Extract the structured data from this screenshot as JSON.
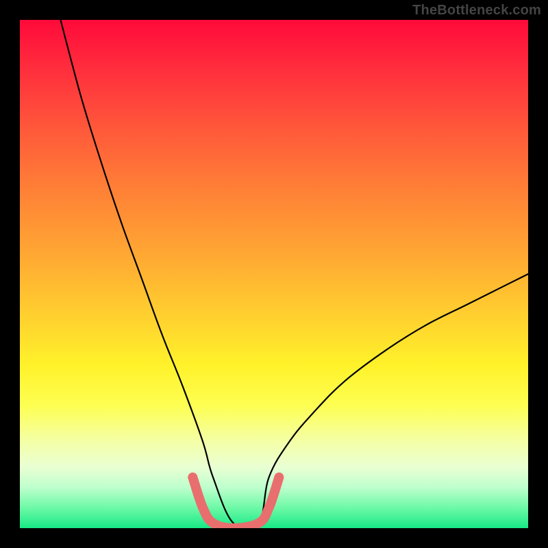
{
  "watermark": "TheBottleneck.com",
  "chart_data": {
    "type": "line",
    "title": "",
    "xlabel": "",
    "ylabel": "",
    "xlim": [
      0,
      100
    ],
    "ylim": [
      0,
      100
    ],
    "grid": false,
    "legend": false,
    "series": [
      {
        "name": "black-curve",
        "description": "V-shaped bottleneck curve with flat minimum, approaches 100% at left edge, about 50% at right edge, zero between ~38 and ~47",
        "color": "#000000",
        "x": [
          8,
          12,
          16,
          20,
          24,
          28,
          32,
          36,
          38,
          42,
          47,
          49,
          53,
          58,
          64,
          72,
          80,
          88,
          96,
          100
        ],
        "values": [
          100,
          85,
          72,
          60,
          49,
          38,
          28,
          17,
          10,
          1,
          1,
          10,
          17,
          23,
          29,
          35,
          40,
          44,
          48,
          50
        ]
      },
      {
        "name": "pink-segment",
        "description": "Thick salmon segment marking the flat bottom of the V",
        "color": "#e96e6e",
        "x": [
          34,
          36,
          38,
          42,
          47,
          49,
          51
        ],
        "values": [
          10,
          4,
          1,
          0,
          1,
          4,
          10
        ]
      }
    ],
    "background_gradient": {
      "stops": [
        {
          "pos": 0,
          "color": "#ff0a3a"
        },
        {
          "pos": 10,
          "color": "#ff2f3d"
        },
        {
          "pos": 22,
          "color": "#ff5a3a"
        },
        {
          "pos": 34,
          "color": "#ff8236"
        },
        {
          "pos": 46,
          "color": "#ffa733"
        },
        {
          "pos": 58,
          "color": "#ffcf2f"
        },
        {
          "pos": 68,
          "color": "#fff22a"
        },
        {
          "pos": 76,
          "color": "#fdff53"
        },
        {
          "pos": 83,
          "color": "#f4ffa7"
        },
        {
          "pos": 88,
          "color": "#e9ffd3"
        },
        {
          "pos": 92,
          "color": "#beffcd"
        },
        {
          "pos": 96,
          "color": "#6df9a6"
        },
        {
          "pos": 100,
          "color": "#18e986"
        }
      ]
    }
  }
}
